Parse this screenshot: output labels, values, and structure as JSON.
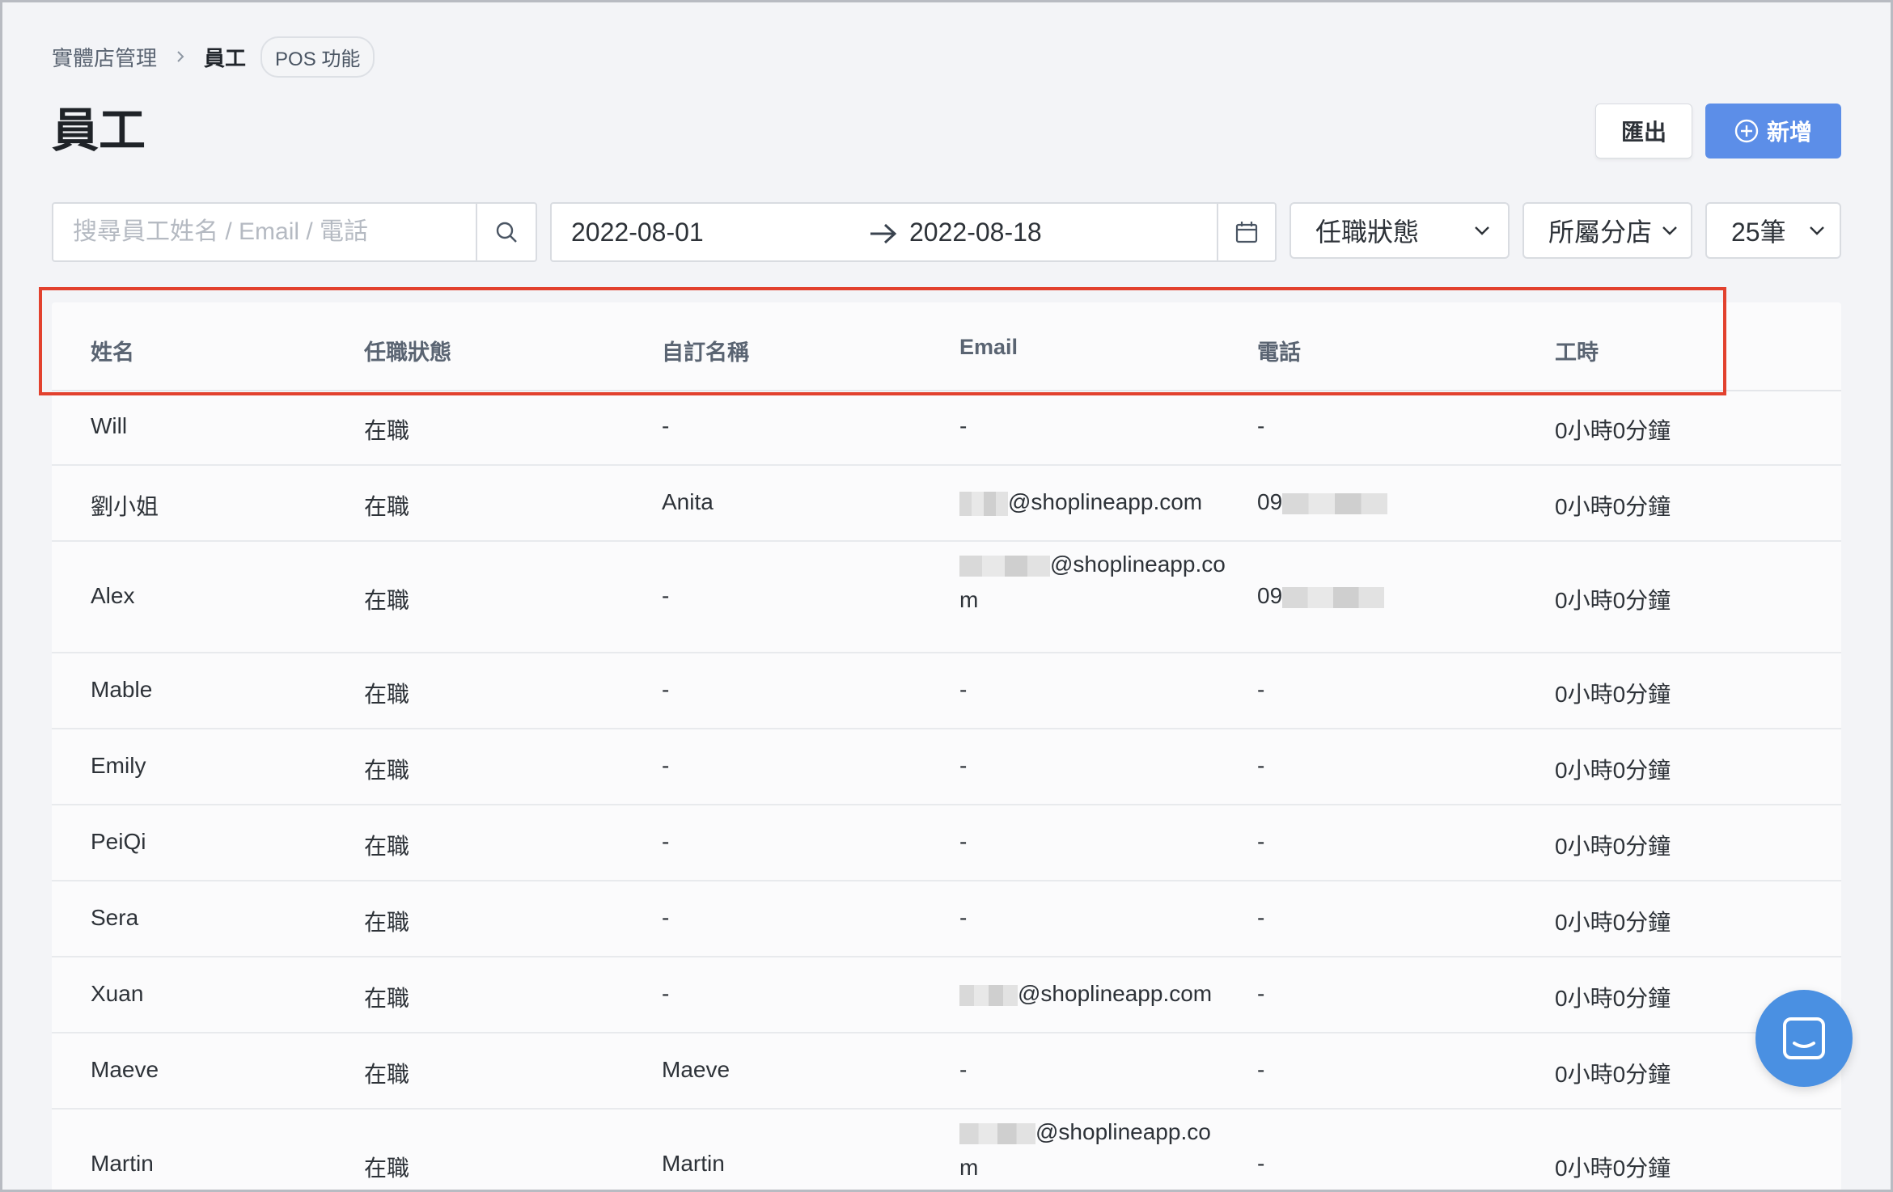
{
  "breadcrumb": {
    "parent": "實體店管理",
    "current": "員工",
    "badge": "POS 功能"
  },
  "page": {
    "title": "員工"
  },
  "actions": {
    "export_label": "匯出",
    "add_label": "新增"
  },
  "filters": {
    "search_placeholder": "搜尋員工姓名 / Email / 電話",
    "date_start": "2022-08-01",
    "date_end": "2022-08-18",
    "status_label": "任職狀態",
    "branch_label": "所屬分店",
    "page_size_label": "25筆"
  },
  "table": {
    "headers": [
      "姓名",
      "任職狀態",
      "自訂名稱",
      "Email",
      "電話",
      "工時"
    ],
    "rows": [
      {
        "name": "Will",
        "status": "在職",
        "custom": "-",
        "email": "-",
        "phone": "-",
        "hours": "0小時0分鐘"
      },
      {
        "name": "劉小姐",
        "status": "在職",
        "custom": "Anita",
        "email": "@shoplineapp.com",
        "phone": "09",
        "hours": "0小時0分鐘"
      },
      {
        "name": "Alex",
        "status": "在職",
        "custom": "-",
        "email": "@shoplineapp.co",
        "email_wrap": "m",
        "phone": "09",
        "hours": "0小時0分鐘"
      },
      {
        "name": "Mable",
        "status": "在職",
        "custom": "-",
        "email": "-",
        "phone": "-",
        "hours": "0小時0分鐘"
      },
      {
        "name": "Emily",
        "status": "在職",
        "custom": "-",
        "email": "-",
        "phone": "-",
        "hours": "0小時0分鐘"
      },
      {
        "name": "PeiQi",
        "status": "在職",
        "custom": "-",
        "email": "-",
        "phone": "-",
        "hours": "0小時0分鐘"
      },
      {
        "name": "Sera",
        "status": "在職",
        "custom": "-",
        "email": "-",
        "phone": "-",
        "hours": "0小時0分鐘"
      },
      {
        "name": "Xuan",
        "status": "在職",
        "custom": "-",
        "email": "@shoplineapp.com",
        "phone": "-",
        "hours": "0小時0分鐘"
      },
      {
        "name": "Maeve",
        "status": "在職",
        "custom": "Maeve",
        "email": "-",
        "phone": "-",
        "hours": "0小時0分鐘"
      },
      {
        "name": "Martin",
        "status": "在職",
        "custom": "Martin",
        "email": "@shoplineapp.co",
        "email_wrap": "m",
        "phone": "-",
        "hours": "0小時0分鐘"
      }
    ]
  },
  "colors": {
    "primary": "#5c8ee8",
    "highlight": "#e2412e",
    "chat": "#4a90e2"
  },
  "icons": {
    "search": "search-icon",
    "calendar": "calendar-icon",
    "chevron": "chevron-down-icon",
    "add": "plus-circle-icon",
    "arrow": "arrow-right-icon",
    "chat": "chat-icon"
  }
}
